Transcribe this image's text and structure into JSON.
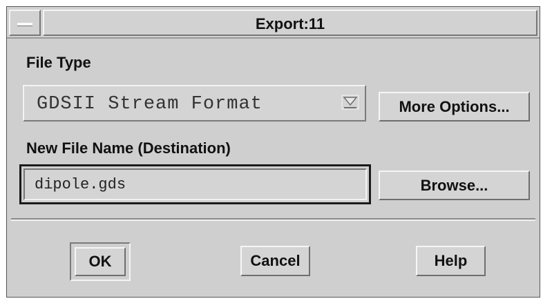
{
  "window": {
    "title": "Export:11"
  },
  "file_type": {
    "label": "File Type",
    "selected": "GDSII Stream Format",
    "more_options_label": "More Options..."
  },
  "destination": {
    "label": "New File Name (Destination)",
    "value": "dipole.gds",
    "browse_label": "Browse..."
  },
  "actions": {
    "ok_label": "OK",
    "cancel_label": "Cancel",
    "help_label": "Help"
  },
  "icons": {
    "window_menu": "window-menu-icon",
    "dropdown": "option-menu-indicator-icon"
  },
  "colors": {
    "background": "#cfcfcf",
    "text": "#111111"
  }
}
